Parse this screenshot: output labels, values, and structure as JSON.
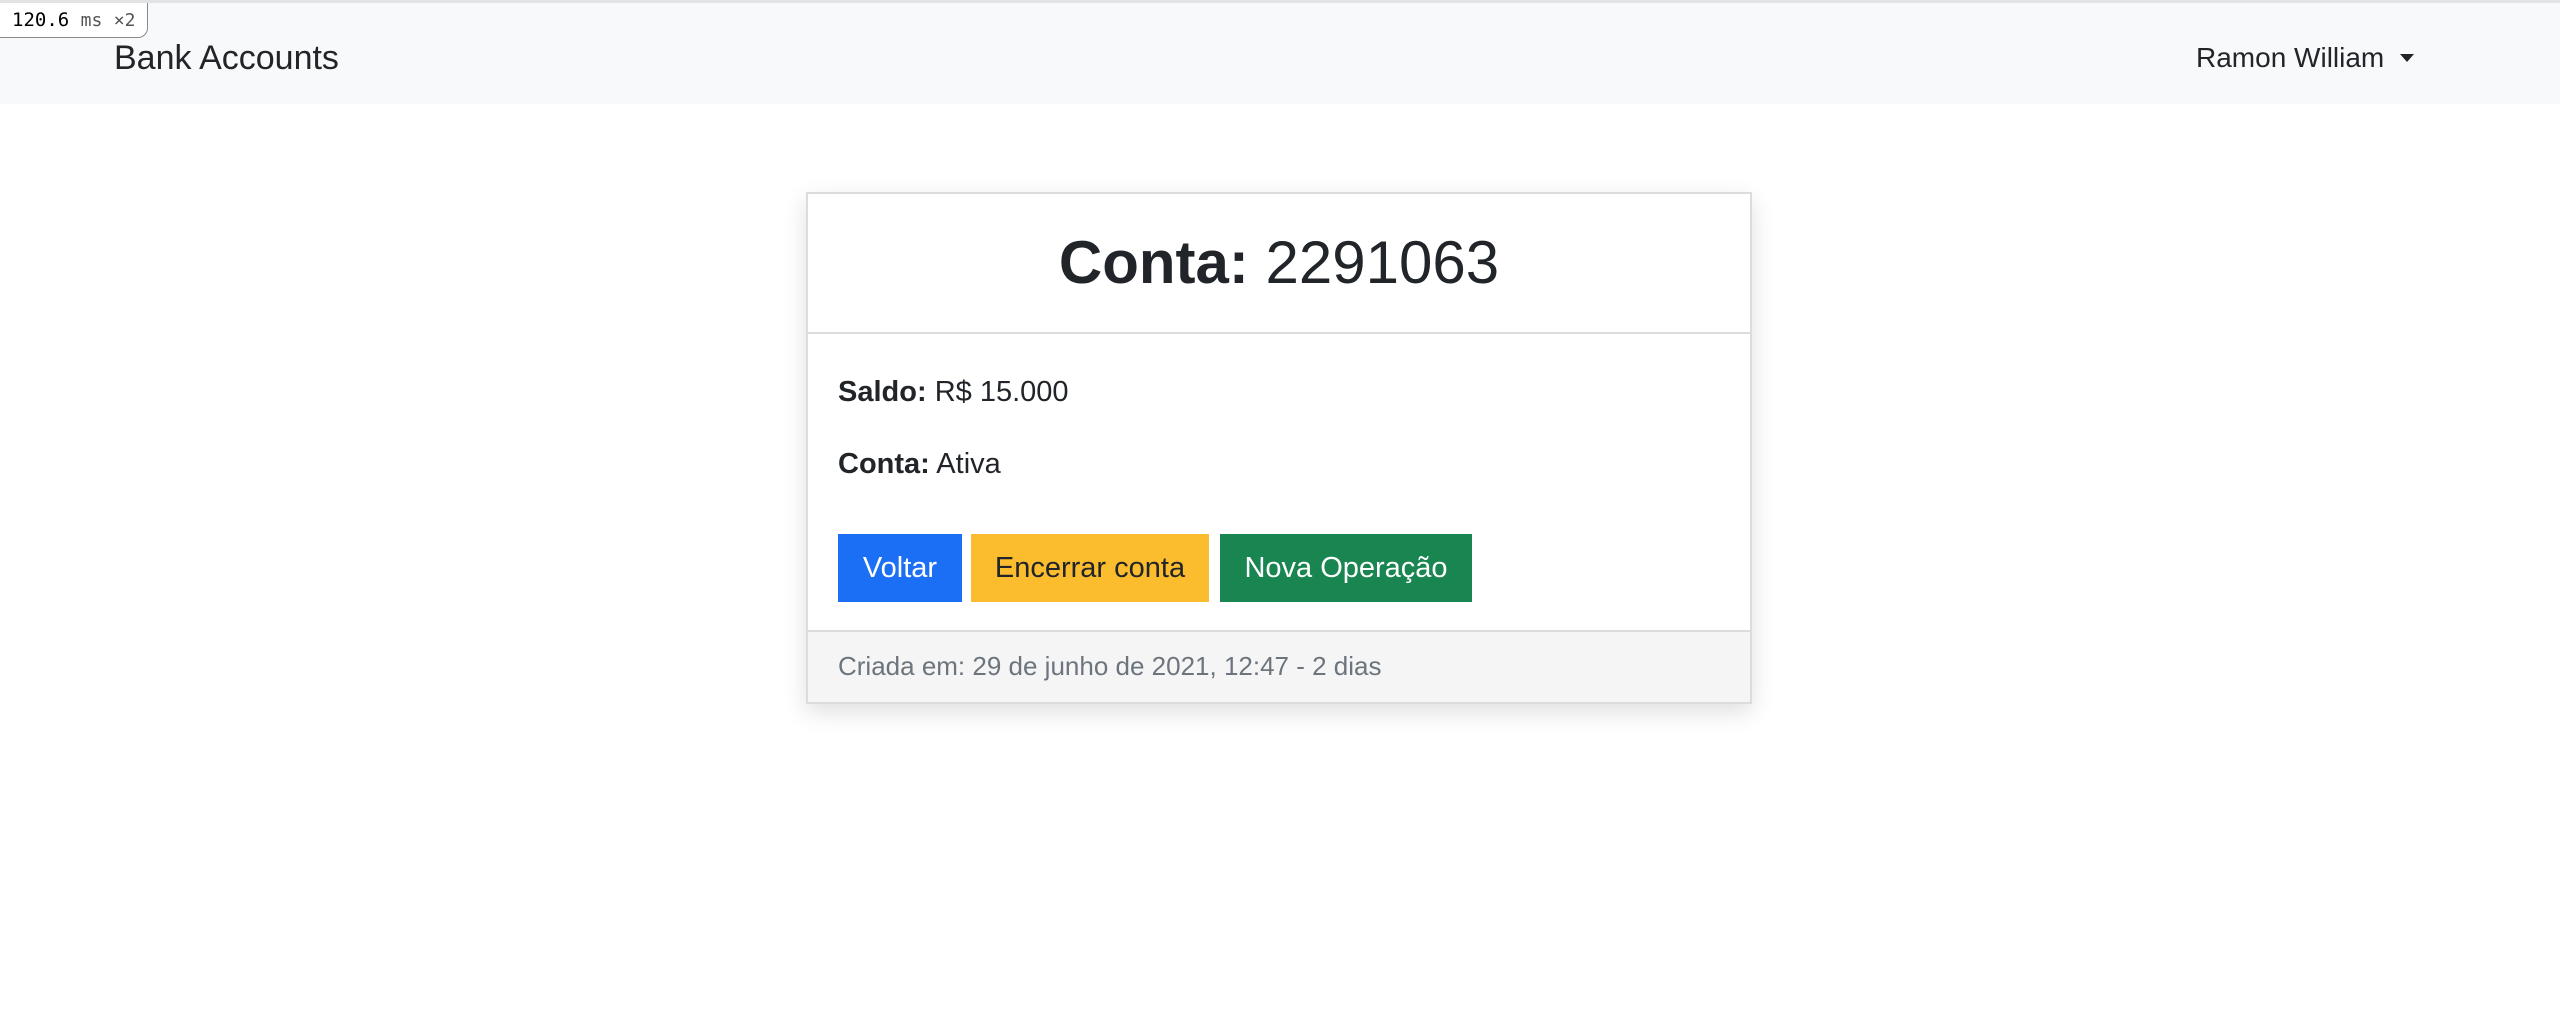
{
  "debug_badge": {
    "value": "120.6",
    "unit": "ms",
    "multiplier": "×2"
  },
  "navbar": {
    "brand": "Bank Accounts",
    "user_name": "Ramon William",
    "user_menu_icon": "caret-down-icon"
  },
  "account": {
    "title_label": "Conta:",
    "number": "2291063",
    "balance_label": "Saldo:",
    "balance_value": "R$ 15.000",
    "status_label": "Conta:",
    "status_value": "Ativa"
  },
  "actions": {
    "back_label": "Voltar",
    "close_account_label": "Encerrar conta",
    "new_operation_label": "Nova Operação"
  },
  "footer": {
    "created_text": "Criada em: 29 de junho de 2021, 12:47 - 2 dias"
  },
  "colors": {
    "primary": "#1a6ff5",
    "warning": "#fbbc2e",
    "success": "#198550",
    "navbar_bg": "#f8f9fa",
    "footer_text": "#6c757d"
  }
}
